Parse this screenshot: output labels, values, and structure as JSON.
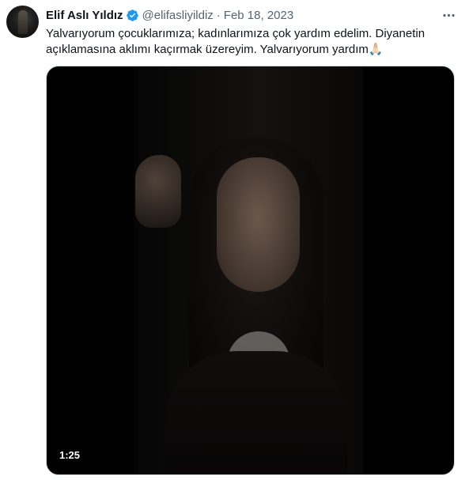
{
  "tweet": {
    "author_name": "Elif Aslı Yıldız",
    "handle": "@elifasliyildiz",
    "separator": "·",
    "date": "Feb 18, 2023",
    "more_icon": "ellipsis-icon",
    "verified_icon": "verified-badge-icon",
    "text": "Yalvarıyorum çocuklarımıza; kadınlarımıza çok yardım edelim. Diyanetin açıklamasına aklımı kaçırmak üzereyim. Yalvarıyorum yardım🙏🏻"
  },
  "media": {
    "type": "video",
    "duration": "1:25"
  },
  "colors": {
    "verified": "#1d9bf0",
    "secondary_text": "#536471",
    "primary_text": "#0f1419",
    "border": "#cfd9de"
  }
}
